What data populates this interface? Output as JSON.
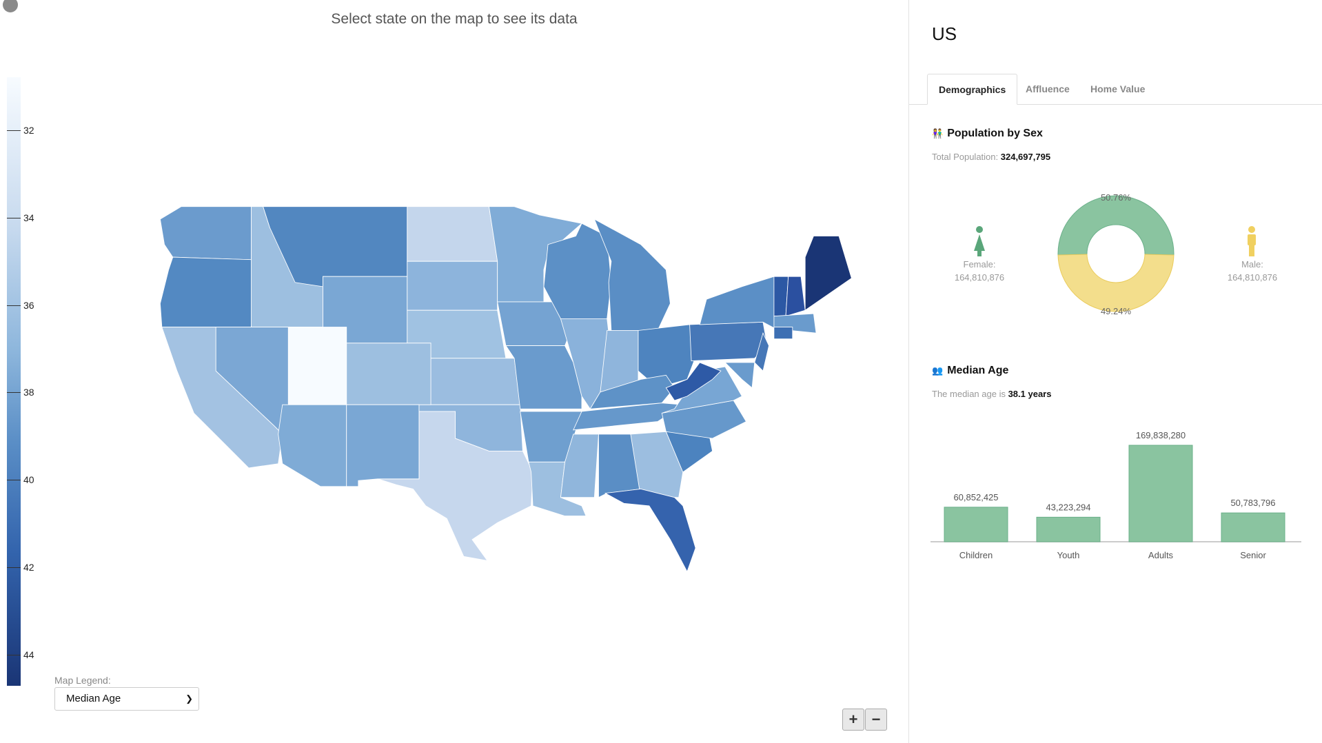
{
  "map": {
    "title": "Select state on the map to see its data",
    "color_scale": {
      "min_color": "#f7fbff",
      "max_color": "#1a3575",
      "ticks": [
        "32",
        "34",
        "36",
        "38",
        "40",
        "42",
        "44"
      ]
    },
    "legend_label": "Map Legend:",
    "legend_select_value": "Median Age",
    "zoom_in": "+",
    "zoom_out": "−"
  },
  "panel": {
    "title": "US",
    "tabs": [
      {
        "label": "Demographics",
        "active": true
      },
      {
        "label": "Affluence"
      },
      {
        "label": "Home Value"
      }
    ],
    "population": {
      "heading": "Population by Sex",
      "total_label": "Total Population:",
      "total_value": "324,697,795",
      "female_label": "Female:",
      "female_value": "164,810,876",
      "male_label": "Male:",
      "male_value": "164,810,876",
      "female_pct": "50.76%",
      "male_pct": "49.24%",
      "female_color": "#8ac4a0",
      "male_color": "#f3de8c"
    },
    "median_age": {
      "heading": "Median Age",
      "text": "The median age is",
      "value": "38.1 years"
    }
  },
  "chart_data": [
    {
      "type": "pie",
      "title": "Population by Sex",
      "categories": [
        "Female",
        "Male"
      ],
      "values": [
        50.76,
        49.24
      ],
      "labels": [
        "50.76%",
        "49.24%"
      ],
      "colors": [
        "#8ac4a0",
        "#f3de8c"
      ]
    },
    {
      "type": "bar",
      "title": "Median Age",
      "categories": [
        "Children",
        "Youth",
        "Adults",
        "Senior"
      ],
      "values": [
        60852425,
        43223294,
        169838280,
        50783796
      ],
      "labels": [
        "60,852,425",
        "43,223,294",
        "169,838,280",
        "50,783,796"
      ],
      "color": "#8ac4a0"
    }
  ]
}
